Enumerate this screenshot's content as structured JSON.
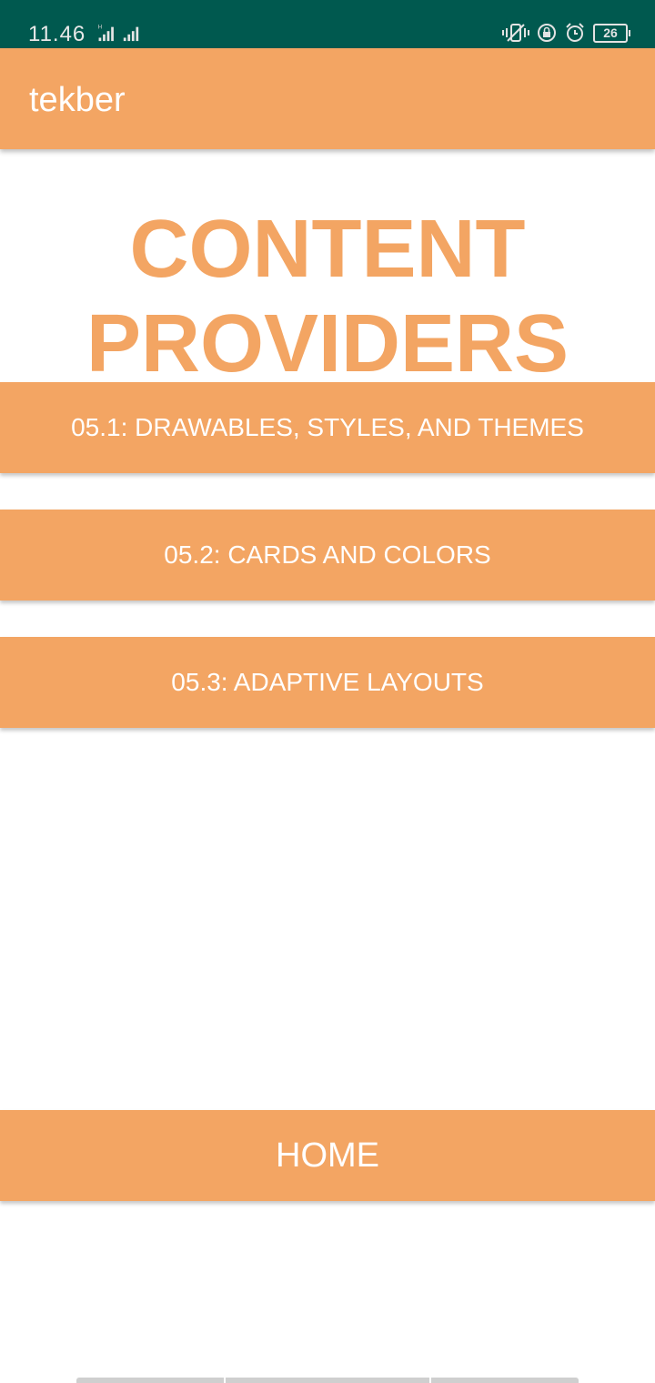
{
  "status_bar": {
    "time": "11.46",
    "network_label": "H",
    "battery_level": "26",
    "icons": [
      "signal-icon",
      "signal-icon",
      "vibrate-icon",
      "lock-icon",
      "alarm-icon",
      "battery-icon"
    ]
  },
  "app_bar": {
    "title": "tekber"
  },
  "heading": {
    "line1": "CONTENT",
    "line2": "PROVIDERS"
  },
  "buttons": {
    "drawables": "05.1: DRAWABLES, STYLES, AND THEMES",
    "cards": "05.2: CARDS AND COLORS",
    "adaptive": "05.3: ADAPTIVE LAYOUTS",
    "home": "HOME"
  },
  "colors": {
    "status_bar": "#00594f",
    "accent": "#f3a563",
    "text_on_accent": "#ffffff",
    "background": "#ffffff"
  }
}
